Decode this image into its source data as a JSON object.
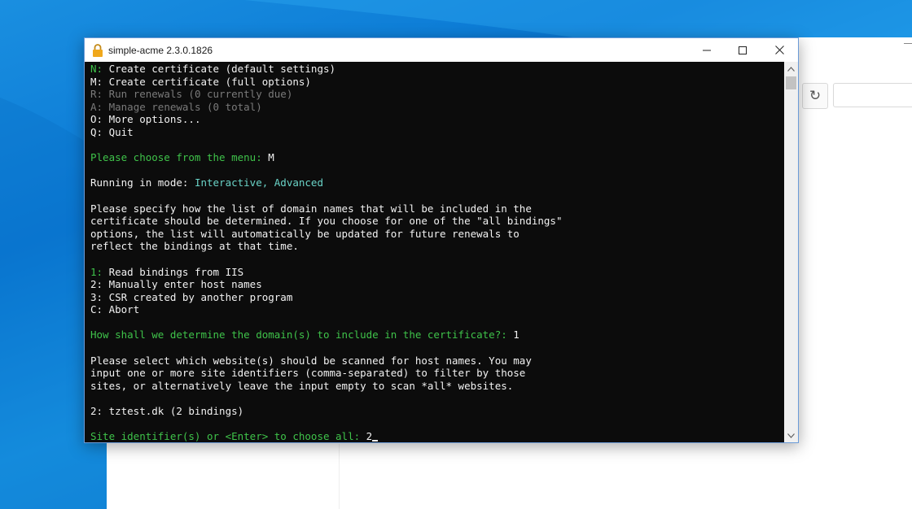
{
  "window": {
    "title": "simple-acme 2.3.0.1826",
    "icon": "padlock-icon"
  },
  "controls": {
    "minimize_icon": "minimize-icon",
    "maximize_icon": "maximize-icon",
    "close_icon": "close-icon"
  },
  "background_app": {
    "refresh_glyph": "↻"
  },
  "console": {
    "menu": [
      {
        "key": "N:",
        "text": " Create certificate (default settings)",
        "dim": false
      },
      {
        "key": "M:",
        "text": " Create certificate (full options)",
        "dim": false
      },
      {
        "key": "R:",
        "text": " Run renewals (0 currently due)",
        "dim": true
      },
      {
        "key": "A:",
        "text": " Manage renewals (0 total)",
        "dim": true
      },
      {
        "key": "O:",
        "text": " More options...",
        "dim": false
      },
      {
        "key": "Q:",
        "text": " Quit",
        "dim": false
      }
    ],
    "menu_prompt": "Please choose from the menu: ",
    "menu_answer": "M",
    "mode_label": "Running in mode: ",
    "mode_value": "Interactive, Advanced",
    "domain_intro": [
      "Please specify how the list of domain names that will be included in the",
      "certificate should be determined. If you choose for one of the \"all bindings\"",
      "options, the list will automatically be updated for future renewals to",
      "reflect the bindings at that time."
    ],
    "source_options": [
      {
        "key": "1:",
        "text": " Read bindings from IIS",
        "highlight": true
      },
      {
        "key": "2:",
        "text": " Manually enter host names",
        "highlight": false
      },
      {
        "key": "3:",
        "text": " CSR created by another program",
        "highlight": false
      },
      {
        "key": "C:",
        "text": " Abort",
        "highlight": false
      }
    ],
    "source_prompt": "How shall we determine the domain(s) to include in the certificate?: ",
    "source_answer": "1",
    "site_intro": [
      "Please select which website(s) should be scanned for host names. You may",
      "input one or more site identifiers (comma-separated) to filter by those",
      "sites, or alternatively leave the input empty to scan *all* websites."
    ],
    "site_option": "2: tztest.dk (2 bindings)",
    "site_prompt": "Site identifier(s) or <Enter> to choose all: ",
    "site_answer": "2"
  },
  "colors": {
    "prompt_green": "#3fc34a",
    "mode_cyan": "#6ad3c7",
    "console_bg": "#0c0c0c",
    "desktop_blue": "#0a78d4"
  }
}
